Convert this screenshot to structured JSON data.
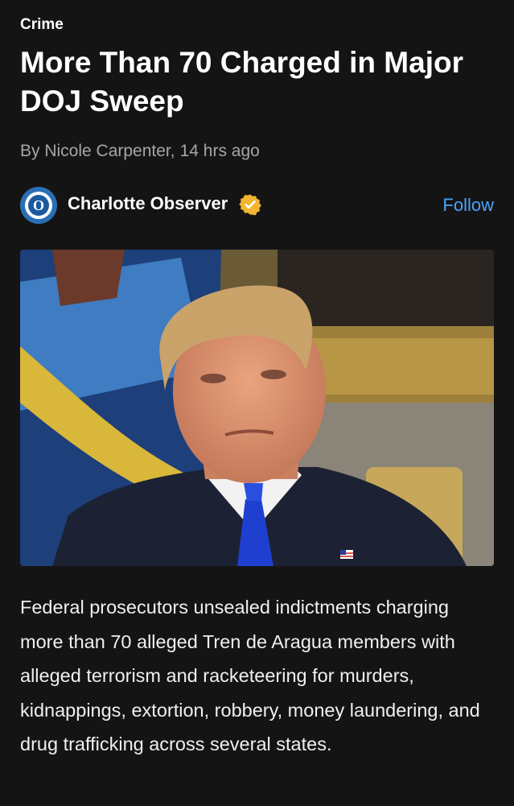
{
  "article": {
    "category": "Crime",
    "headline": "More Than 70 Charged in Major DOJ Sweep",
    "byline_author": "By Nicole Carpenter,",
    "byline_time": "14 hrs ago",
    "source": {
      "name": "Charlotte Observer",
      "follow_label": "Follow",
      "verified_color": "#f2b531",
      "logo_color": "#1c5aa0"
    },
    "body": "Federal prosecutors unsealed indictments charging more than 70 alleged Tren de Aragua members with alleged terrorism and racketeering for murders, kidnappings, extortion, robbery, money laundering, and drug trafficking across several states."
  },
  "colors": {
    "background": "#141414",
    "link": "#4aa3ff",
    "byline": "#a6a6a6"
  }
}
